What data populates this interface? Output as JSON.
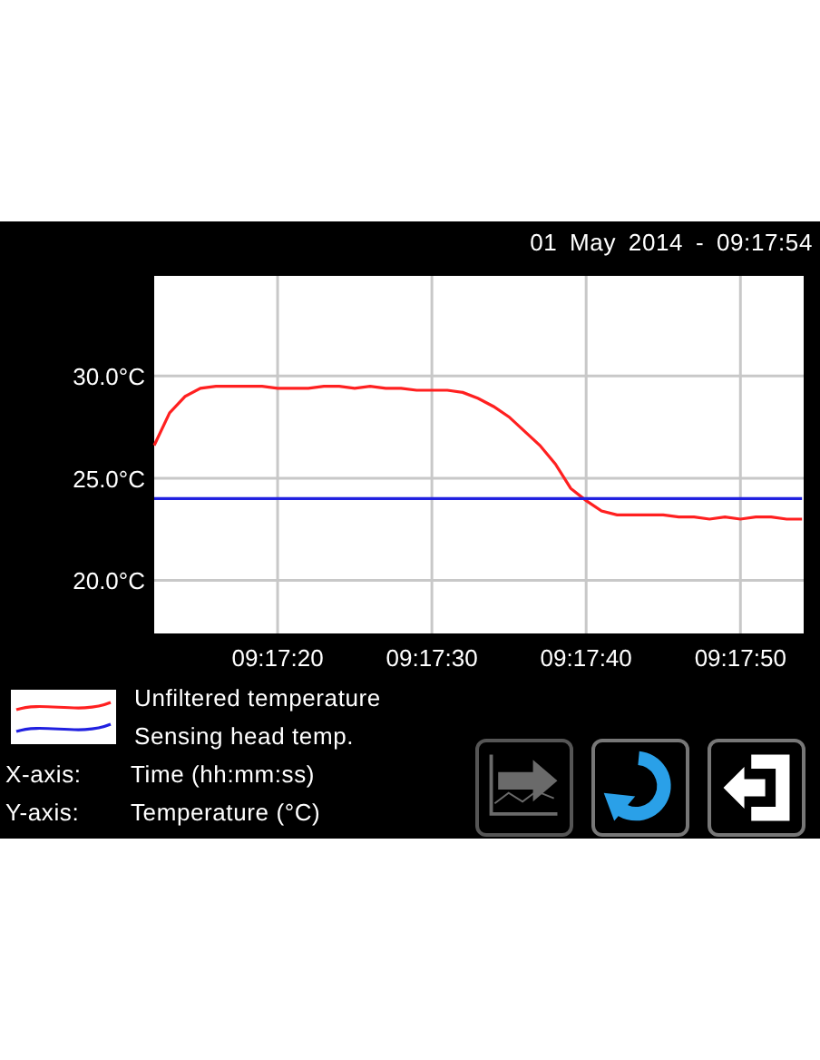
{
  "header": {
    "datetime": "01 May 2014 - 09:17:54"
  },
  "chart": {
    "chart_data": {
      "type": "line",
      "categories": [
        null,
        null,
        null,
        null,
        null,
        null,
        null,
        null,
        "09:17:20",
        null,
        null,
        null,
        null,
        null,
        null,
        null,
        null,
        null,
        "09:17:30",
        null,
        null,
        null,
        null,
        null,
        null,
        null,
        null,
        null,
        "09:17:40",
        null,
        null,
        null,
        null,
        null,
        null,
        null,
        null,
        null,
        "09:17:50",
        null,
        null,
        null,
        null
      ],
      "series": [
        {
          "name": "Unfiltered temperature",
          "color": "#ff2020",
          "values": [
            26.6,
            28.2,
            29.0,
            29.4,
            29.5,
            29.5,
            29.5,
            29.5,
            29.4,
            29.4,
            29.4,
            29.5,
            29.5,
            29.4,
            29.5,
            29.4,
            29.4,
            29.3,
            29.3,
            29.3,
            29.2,
            28.9,
            28.5,
            28.0,
            27.3,
            26.6,
            25.7,
            24.5,
            23.9,
            23.4,
            23.2,
            23.2,
            23.2,
            23.2,
            23.1,
            23.1,
            23.0,
            23.1,
            23.0,
            23.1,
            23.1,
            23.0,
            23.0
          ]
        },
        {
          "name": "Sensing head temp.",
          "color": "#2020e0",
          "values": [
            24.0,
            24.0,
            24.0,
            24.0,
            24.0,
            24.0,
            24.0,
            24.0,
            24.0,
            24.0,
            24.0,
            24.0,
            24.0,
            24.0,
            24.0,
            24.0,
            24.0,
            24.0,
            24.0,
            24.0,
            24.0,
            24.0,
            24.0,
            24.0,
            24.0,
            24.0,
            24.0,
            24.0,
            24.0,
            24.0,
            24.0,
            24.0,
            24.0,
            24.0,
            24.0,
            24.0,
            24.0,
            24.0,
            24.0,
            24.0,
            24.0,
            24.0,
            24.0
          ]
        }
      ],
      "ylim": [
        17.4,
        34.9
      ],
      "grid": true,
      "yticks": [
        {
          "value": 20,
          "label": "20.0°C"
        },
        {
          "value": 25,
          "label": "25.0°C"
        },
        {
          "value": 30,
          "label": "30.0°C"
        }
      ]
    }
  },
  "axes_info": [
    {
      "label": "X-axis:",
      "value": "Time (hh:mm:ss)"
    },
    {
      "label": "Y-axis:",
      "value": "Temperature (°C)"
    }
  ],
  "buttons": [
    {
      "kind": "export",
      "disabled": true
    },
    {
      "kind": "refresh",
      "disabled": false
    },
    {
      "kind": "exit",
      "disabled": false
    }
  ]
}
